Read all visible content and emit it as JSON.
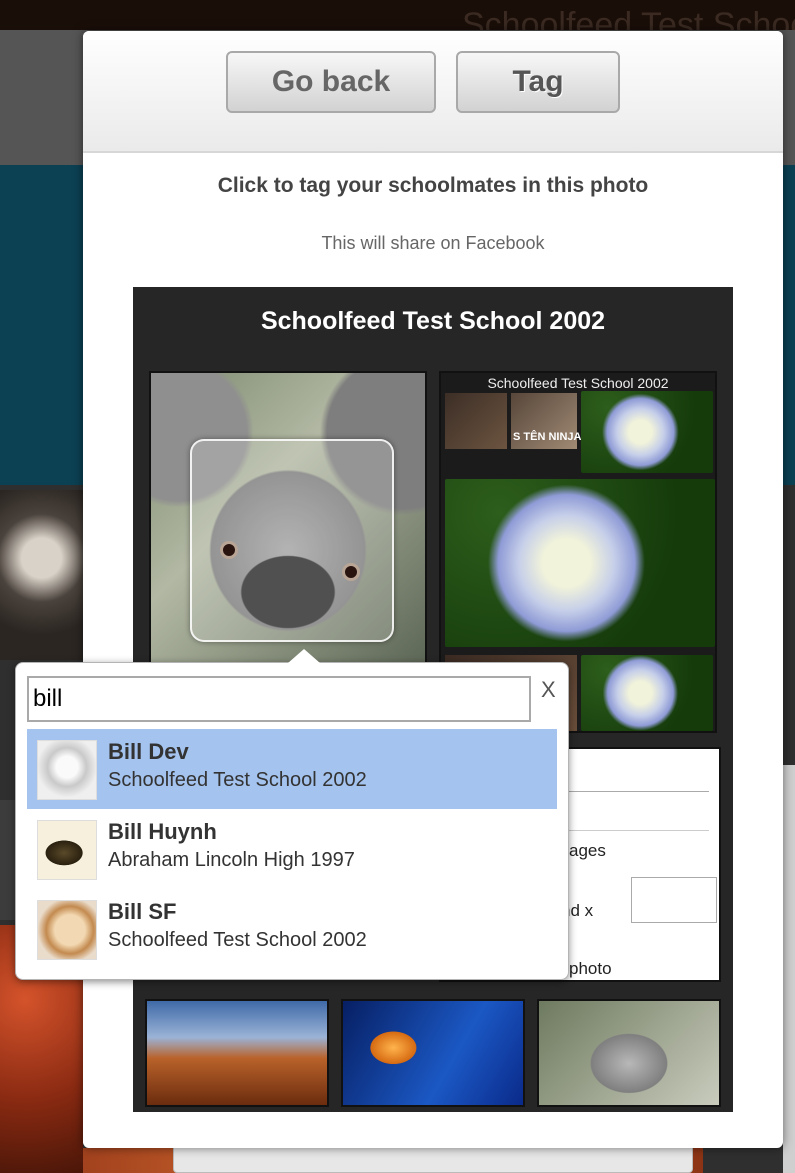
{
  "background": {
    "title": "Schoolfeed Test School"
  },
  "modal": {
    "go_back_label": "Go back",
    "tag_label": "Tag",
    "heading": "Click to tag your schoolmates in this photo",
    "subheading": "This will share on Facebook"
  },
  "photo_panel": {
    "title": "Schoolfeed Test School 2002",
    "collage_title": "Schoolfeed Test School 2002",
    "collage_caption": "S TÊN NINJA",
    "doc_snippets": {
      "pages": "ages",
      "y_and_x": "Y, and x",
      "photo": "photo"
    }
  },
  "tag_search": {
    "query": "bill",
    "close_label": "X",
    "results": [
      {
        "name": "Bill Dev",
        "school": "Schoolfeed Test School 2002",
        "selected": true,
        "avatar": "gorilla-sketch"
      },
      {
        "name": "Bill Huynh",
        "school": "Abraham Lincoln High 1997",
        "selected": false,
        "avatar": "dragon"
      },
      {
        "name": "Bill SF",
        "school": "Schoolfeed Test School 2002",
        "selected": false,
        "avatar": "puppy"
      }
    ]
  },
  "colors": {
    "selected_row": "#a4c3ee",
    "panel_bg": "#262626",
    "overlay_teal": "#0b4153"
  }
}
